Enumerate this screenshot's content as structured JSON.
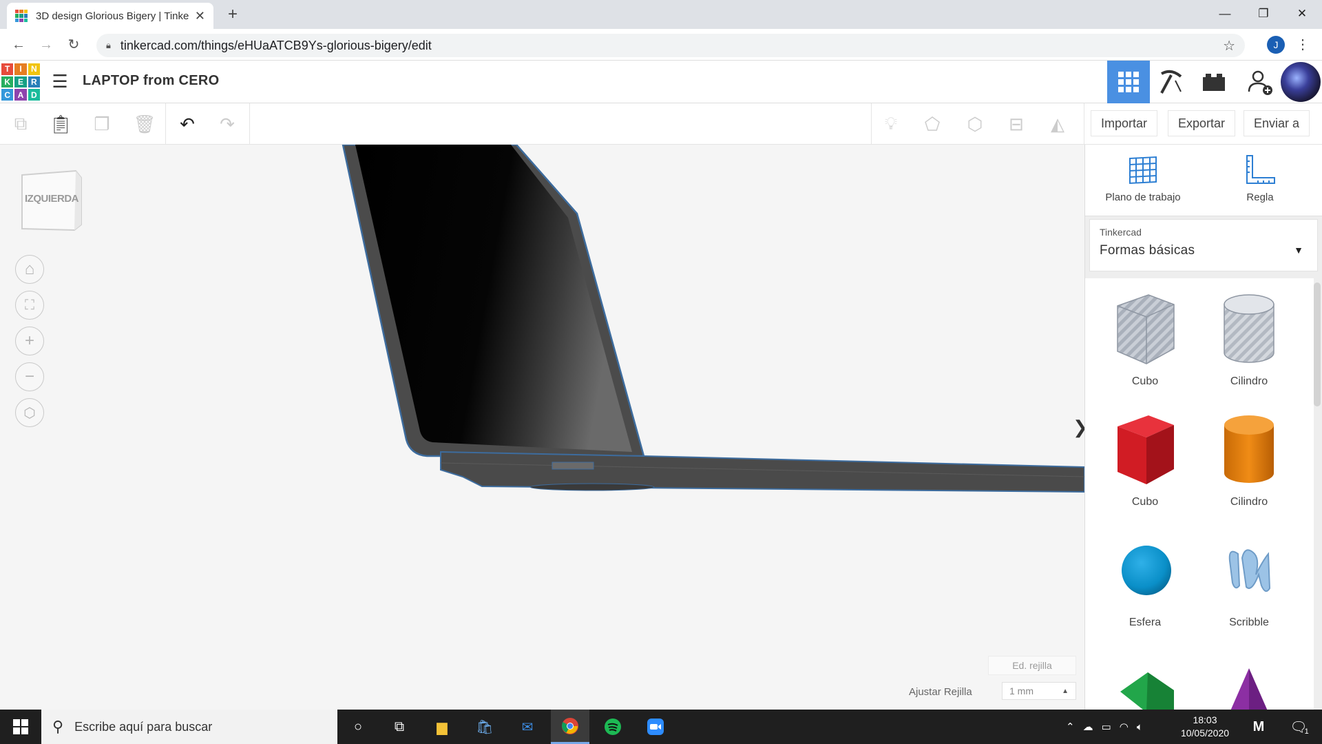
{
  "browser": {
    "tab_title": "3D design Glorious Bigery | Tinke",
    "tab_close": "✕",
    "new_tab": "+",
    "url": "tinkercad.com/things/eHUaATCB9Ys-glorious-bigery/edit",
    "profile_initial": "J",
    "window_controls": {
      "minimize": "—",
      "maximize": "❐",
      "close": "✕"
    }
  },
  "app": {
    "logo_letters": [
      "T",
      "I",
      "N",
      "K",
      "E",
      "R",
      "C",
      "A",
      "D"
    ],
    "logo_colors": [
      "#e74c3c",
      "#e67e22",
      "#f1c40f",
      "#27ae60",
      "#16a085",
      "#2980b9",
      "#3498db",
      "#8e44ad",
      "#1abc9c"
    ],
    "design_name": "LAPTOP from CERO",
    "accent": "#4a90e2"
  },
  "toolbar": {
    "import_label": "Importar",
    "export_label": "Exportar",
    "send_label": "Enviar a"
  },
  "workspace": {
    "view_cube_label": "IZQUIERDA",
    "edit_grid_label": "Ed. rejilla",
    "snap_label": "Ajustar Rejilla",
    "snap_value": "1 mm"
  },
  "sidebar": {
    "workplane_label": "Plano de trabajo",
    "ruler_label": "Regla",
    "library_caption": "Tinkercad",
    "library_value": "Formas básicas",
    "shapes": [
      {
        "label": "Cubo",
        "icon": "striped-box-icon"
      },
      {
        "label": "Cilindro",
        "icon": "striped-cylinder-icon"
      },
      {
        "label": "Cubo",
        "icon": "red-box-icon"
      },
      {
        "label": "Cilindro",
        "icon": "orange-cylinder-icon"
      },
      {
        "label": "Esfera",
        "icon": "blue-sphere-icon"
      },
      {
        "label": "Scribble",
        "icon": "scribble-icon"
      }
    ]
  },
  "taskbar": {
    "search_placeholder": "Escribe aquí para buscar",
    "time": "18:03",
    "date": "10/05/2020",
    "notification_count": "1"
  }
}
